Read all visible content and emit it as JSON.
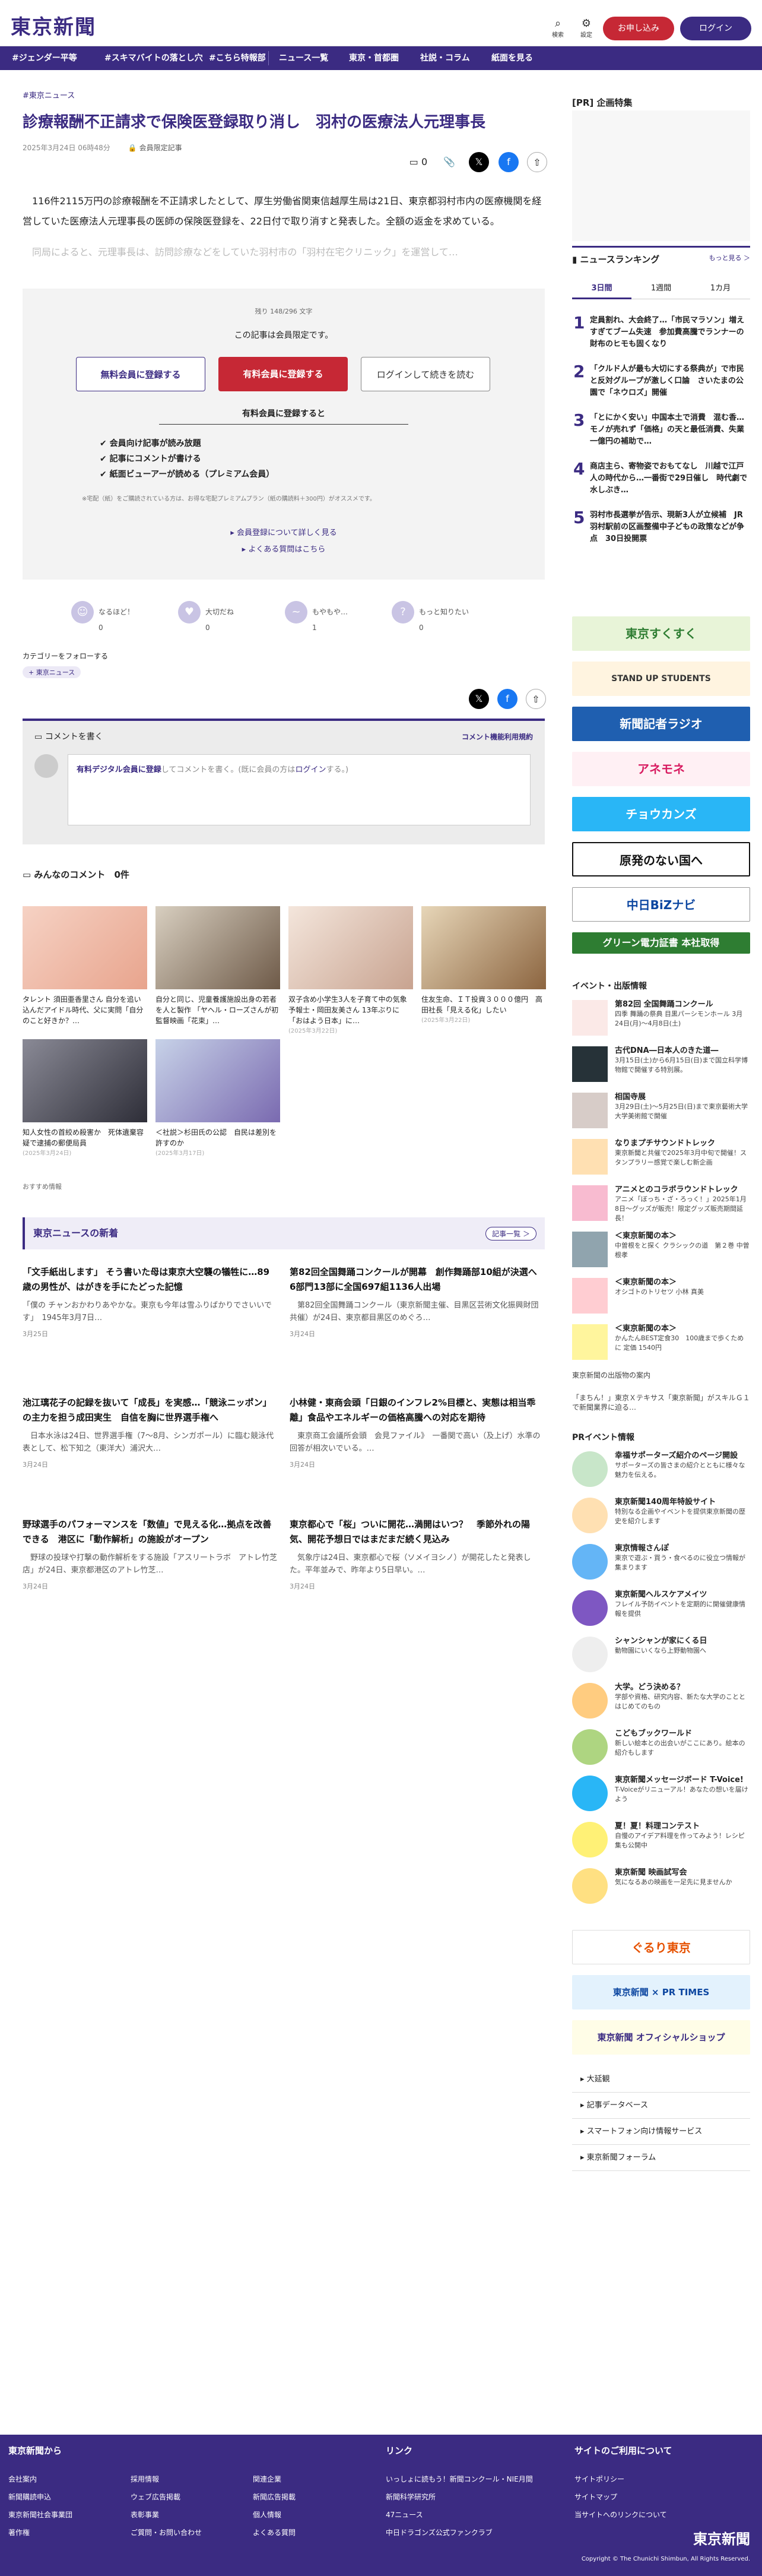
{
  "header": {
    "logo": "東京新聞",
    "search_label": "検索",
    "settings_label": "設定",
    "subscribe": "お申し込み",
    "login": "ログイン"
  },
  "nav": [
    "#ジェンダー平等",
    "#スキマバイトの落とし穴",
    "#こちら特報部",
    "ニュース一覧",
    "東京・首都圏",
    "社説・コラム",
    "紙面を見る"
  ],
  "article": {
    "category": "東京ニュース",
    "title": "診療報酬不正請求で保険医登録取り消し　羽村の医療法人元理事長",
    "date": "2025年3月24日 06時48分",
    "member_label": "会員限定記事",
    "comment_count": "0",
    "p1": "　116件2115万円の診療報酬を不正請求したとして、厚生労働省関東信越厚生局は21日、東京都羽村市内の医療機関を経営していた医療法人元理事長の医師の保険医登録を、22日付で取り消すと発表した。全額の返金を求めている。",
    "p2": "　同局によると、元理事長は、訪問診療などをしていた羽村市の「羽村在宅クリニック」を運営して…"
  },
  "paywall": {
    "remain": "残り 148/296 文字",
    "notice": "この記事は会員限定です。",
    "btn_free": "無料会員に登録する",
    "btn_paid": "有料会員に登録する",
    "btn_login": "ログインして続きを読む",
    "benefit_title": "有料会員に登録すると",
    "benefits": [
      "会員向け記事が読み放題",
      "記事にコメントが書ける",
      "紙面ビューアーが読める（プレミアム会員）"
    ],
    "note": "※宅配（紙）をご購読されている方は、お得な宅配プレミアムプラン（紙の購読料＋300円）がオススメです。",
    "link1": "会員登録について詳しく見る",
    "link2": "よくある質問はこちら"
  },
  "reactions": [
    {
      "label": "なるほど！",
      "count": "0"
    },
    {
      "label": "大切だね",
      "count": "0"
    },
    {
      "label": "もやもや…",
      "count": "1"
    },
    {
      "label": "もっと知りたい",
      "count": "0"
    }
  ],
  "follow": {
    "label": "カテゴリーをフォローする",
    "tag": "東京ニュース"
  },
  "comment": {
    "title": "コメントを書く",
    "rules": "コメント機能利用規約",
    "placeholder_member": "有料デジタル会員に登録",
    "placeholder_rest": "してコメントを書く。(既に会員の方は",
    "placeholder_login": "ログイン",
    "placeholder_end": "する。)"
  },
  "everyone": {
    "title": "みんなのコメント",
    "count": "0件"
  },
  "cards": [
    {
      "text": "タレント 須田亜香里さん 自分を追い込んだアイドル時代、父に実問「自分のこと好きか？…",
      "date": ""
    },
    {
      "text": "自分と同じ、児童養護施設出身の若者を人と製作 「ヤヘル・ローズさんが初監督映画「花束」…",
      "date": ""
    },
    {
      "text": "双子含め小学生3人を子育て中の気象予報士・岡田友美さん 13年ぶりに「おはよう日本」に…",
      "date": "(2025年3月22日)"
    },
    {
      "text": "住友生命、ＩＴ投資３０００億円　高田社長「見える化」したい",
      "date": "(2025年3月22日)"
    },
    {
      "text": "知人女性の首絞め殺害か　死体遺棄容疑で逮捕の郵便局員",
      "date": "(2025年3月24日)"
    },
    {
      "text": "＜社説＞杉田氏の公認　自民は差別を許すのか",
      "date": "(2025年3月17日)"
    }
  ],
  "recommend_label": "おすすめ情報",
  "news": {
    "title": "東京ニュースの新着",
    "more": "記事一覧 ＞",
    "items": [
      {
        "t": "「文手紙出します」 そう書いた母は東京大空襲の犠牲に…89歳の男性が、はがきを手にたどった記憶",
        "x": "「僕の チャンおかわりあやかな。東京も今年は雪ふりばかりでさいいです」　1945年3月7日…",
        "d": "3月25日"
      },
      {
        "t": "第82回全国舞踊コンクールが開幕　創作舞踊部10組が決選へ　6部門13部に全国697組1136人出場",
        "x": "　第82回全国舞踊コンクール（東京新聞主催、目黒区芸術文化振興財団共催）が24日、東京都目黒区のめぐろ…",
        "d": "3月24日"
      },
      {
        "t": "池江璃花子の記録を抜いて「成長」を実感…「競泳ニッポン」の主力を担う成田実生　自信を胸に世界選手権へ",
        "x": "　日本水泳は24日、世界選手権（7～8月、シンガポール）に臨む競泳代表として、松下知之（東洋大）浦沢大…",
        "d": "3月24日"
      },
      {
        "t": "小林健・東商会頭「日銀のインフレ2%目標と、実態は相当乖離」食品やエネルギーの価格高騰への対応を期待",
        "x": "　東京商工会議所会頭　会見ファイル》　一番関で高い（及上げ）水準の回答が相次いでいる。…",
        "d": "3月24日"
      },
      {
        "t": "野球選手のパフォーマンスを「数値」で見える化…拠点を改善できる　港区に「動作解析」の施設がオープン",
        "x": "　野球の投球や打撃の動作解析をする施設「アスリートラボ　アトレ竹芝店」が24日、東京都港区のアトレ竹芝…",
        "d": "3月24日"
      },
      {
        "t": "東京都心で「桜」ついに開花…満開はいつ？　季節外れの陽気、開花予想日ではまだまだ続く見込み",
        "x": "　気象庁は24日、東京都心で桜（ソメイヨシノ）が開花したと発表した。平年並みで、昨年より5日早い。…",
        "d": "3月24日"
      }
    ]
  },
  "side": {
    "pr_special": "[PR] 企画特集",
    "ranking_title": "ニュースランキング",
    "ranking_more": "もっと見る ＞",
    "tabs": [
      "3日間",
      "1週間",
      "1カ月"
    ],
    "ranking": [
      {
        "n": "1",
        "t": "定員割れ、大会終了…「市民マラソン」増えすぎてブーム失速　参加費高騰でランナーの財布のヒモも固くなり"
      },
      {
        "n": "2",
        "t": "「クルド人が最も大切にする祭典が」で市民と反対グループが激しく口論　さいたまの公園で「ネウロズ」開催"
      },
      {
        "n": "3",
        "t": "「とにかく安い」中国本土で消費　混む香…モノが売れず「価格」の天と最低消費、失業　一億円の補助で…"
      },
      {
        "n": "4",
        "t": "商店主ら、寄物姿でおもてなし　川越で江戸人の時代から…一番街で29日催し　時代劇で水しぶき…"
      },
      {
        "n": "5",
        "t": "羽村市長選挙が告示、現新3人が立候補　JR羽村駅前の区画整備中子どもの政策などが争点　30日投開票"
      }
    ],
    "banners": [
      {
        "t": "東京すくすく",
        "bg": "#e8f4d8",
        "fg": "#2e7d32"
      },
      {
        "t": "STAND UP STUDENTS",
        "bg": "#fff4e0",
        "fg": "#333"
      },
      {
        "t": "新聞記者ラジオ",
        "bg": "#1f5fb0",
        "fg": "#fff"
      },
      {
        "t": "アネモネ",
        "bg": "#fff0f4",
        "fg": "#d81b60"
      },
      {
        "t": "チョウカンズ",
        "bg": "#29b6f6",
        "fg": "#fff"
      },
      {
        "t": "原発のない国へ",
        "bg": "#fff",
        "fg": "#111"
      },
      {
        "t": "中日BiZナビ",
        "bg": "#fff",
        "fg": "#0d47a1"
      },
      {
        "t": "グリーン電力証書 本社取得",
        "bg": "#2e7d32",
        "fg": "#fff"
      }
    ],
    "events_title": "イベント・出版情報",
    "events": [
      {
        "t": "第82回 全国舞踊コンクール",
        "x": "四季 舞踊の祭典 目黒パーシモンホール 3月24日(月)〜4月8日(土)"
      },
      {
        "t": "古代DNA―日本人のきた道―",
        "x": "3月15日(土)から6月15日(日)まで国立科学博物館で開催する特別展。"
      },
      {
        "t": "相国寺展",
        "x": "3月29日(土)〜5月25日(日)まで東京藝術大学大学美術館で開催"
      },
      {
        "t": "なりまプチサウンドトレック",
        "x": "東京新聞と共催で2025年3月中旬で開催！スタンプラリー感覚で楽しむ新企画"
      },
      {
        "t": "アニメとのコラボラウンドトレック",
        "x": "アニメ「ぼっち・ざ・ろっく！」2025年1月8日〜グッズが販売！限定グッズ販売期間延長！"
      },
      {
        "t": "＜東京新聞の本＞",
        "x": "中曽根をと探く クラシックの道　第２巻 中曽根孝"
      },
      {
        "t": "＜東京新聞の本＞",
        "x": "オシゴトのトリセツ 小林 真美"
      },
      {
        "t": "＜東京新聞の本＞",
        "x": "かんたんBEST定食30　100歳まで歩くために 定価 1540円"
      },
      {
        "t": "東京新聞の出版物の案内",
        "x": ""
      },
      {
        "t": "「まちん！」東京Ｘテキサス「東京新聞」がスキルＧ１で新聞業界に迫る…",
        "x": ""
      }
    ],
    "pr_title": "PRイベント情報",
    "pr": [
      {
        "t": "幸福サポーターズ紹介のページ開設",
        "x": "サポーターズの皆さまの紹介とともに様々な魅力を伝える。",
        "c": "#c8e6c9"
      },
      {
        "t": "東京新聞140周年特設サイト",
        "x": "特別なる企画やイベントを提供東京新聞の歴史を紹介します",
        "c": "#ffe0b2"
      },
      {
        "t": "東京情報さんぽ",
        "x": "東京で遊ぶ・買う・食べるのに役立つ情報が集まります",
        "c": "#64b5f6"
      },
      {
        "t": "東京新聞ヘルスケアメイツ",
        "x": "フレイル予防イベントを定期的に開催健康情報を提供",
        "c": "#7e57c2"
      },
      {
        "t": "シャンシャンが家にくる日",
        "x": "動物園にいくなら上野動物園へ",
        "c": "#eeeeee"
      },
      {
        "t": "大学。どう決める？",
        "x": "学部や資格、研究内容、新たな大学のこととはじめてのもの",
        "c": "#ffcc80"
      },
      {
        "t": "こどもブックワールド",
        "x": "新しい絵本との出会いがここにあり。絵本の紹介もします",
        "c": "#aed581"
      },
      {
        "t": "東京新聞メッセージボード T-Voice!",
        "x": "T-Voiceがリニューアル！あなたの想いを届けよう",
        "c": "#29b6f6"
      },
      {
        "t": "夏！夏！料理コンテスト",
        "x": "自慢のアイデア料理を作ってみよう！レシピ集も公開中",
        "c": "#fff176"
      },
      {
        "t": "東京新聞 映画試写会",
        "x": "気になるあの映画を一足先に見ませんか",
        "c": "#ffe082"
      }
    ],
    "bottom_banners": [
      "ぐるり東京",
      "東京新聞 × PR TIMES",
      "東京新聞 オフィシャルショップ"
    ],
    "links": [
      "大延観",
      "記事データベース",
      "スマートフォン向け情報サービス",
      "東京新聞フォーラム"
    ]
  },
  "footer": {
    "col1": "東京新聞から",
    "col1_items": [
      "会社案内",
      "採用情報",
      "関連企業",
      "新聞購読申込",
      "ウェブ広告掲載",
      "新聞広告掲載",
      "東京新聞社会事業団",
      "表彰事業",
      "個人情報",
      "著作権",
      "ご質問・お問い合わせ",
      "よくある質問"
    ],
    "col2": "リンク",
    "col2_items": [
      "いっしょに読もう！新聞コンクール・NIE月間",
      "新聞科学研究所",
      "47ニュース",
      "中日ドラゴンズ公式ファンクラブ"
    ],
    "col3": "サイトのご利用について",
    "col3_items": [
      "サイトポリシー",
      "サイトマップ",
      "当サイトへのリンクについて"
    ],
    "copy": "Copyright © The Chunichi Shimbun, All Rights Reserved.",
    "logo": "東京新聞"
  }
}
